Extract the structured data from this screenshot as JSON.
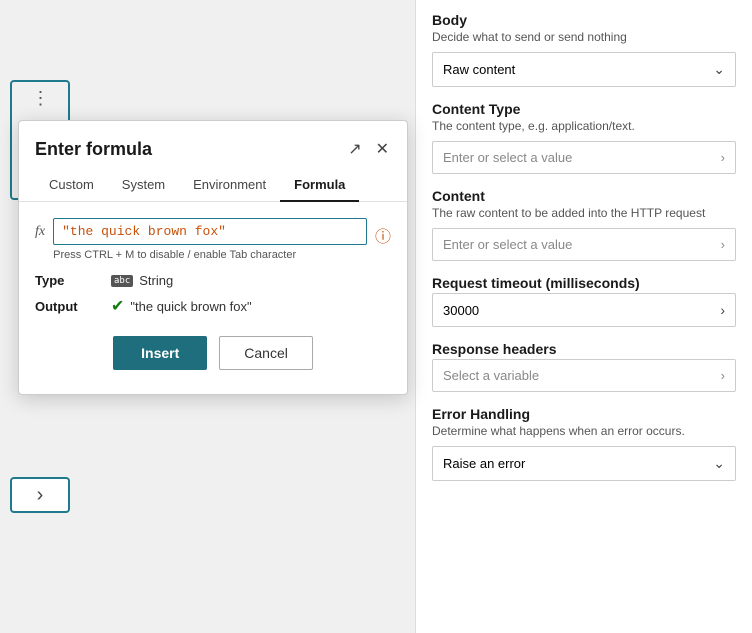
{
  "modal": {
    "title": "Enter formula",
    "tabs": [
      {
        "id": "custom",
        "label": "Custom",
        "active": false
      },
      {
        "id": "system",
        "label": "System",
        "active": false
      },
      {
        "id": "environment",
        "label": "Environment",
        "active": false
      },
      {
        "id": "formula",
        "label": "Formula",
        "active": true
      }
    ],
    "fx_label": "fx",
    "formula_value": "\"the quick brown fox\"",
    "formula_hint": "Press CTRL + M to disable / enable Tab character",
    "type_label": "Type",
    "type_icon": "abc",
    "type_value": "String",
    "output_label": "Output",
    "output_value": "\"the quick brown fox\"",
    "insert_label": "Insert",
    "cancel_label": "Cancel"
  },
  "right_panel": {
    "body_title": "Body",
    "body_sub": "Decide what to send or send nothing",
    "body_value": "Raw content",
    "content_type_title": "Content Type",
    "content_type_sub": "The content type, e.g. application/text.",
    "content_type_placeholder": "Enter or select a value",
    "content_title": "Content",
    "content_sub": "The raw content to be added into the HTTP request",
    "content_placeholder": "Enter or select a value",
    "request_timeout_title": "Request timeout (milliseconds)",
    "request_timeout_value": "30000",
    "response_headers_title": "Response headers",
    "response_headers_placeholder": "Select a variable",
    "error_handling_title": "Error Handling",
    "error_handling_sub": "Determine what happens when an error occurs.",
    "error_handling_value": "Raise an error"
  },
  "icons": {
    "expand": "↗",
    "close": "✕",
    "chevron_right": "›",
    "chevron_down": "⌄",
    "check": "✔",
    "info": "ⓘ",
    "dots": "⋮"
  }
}
